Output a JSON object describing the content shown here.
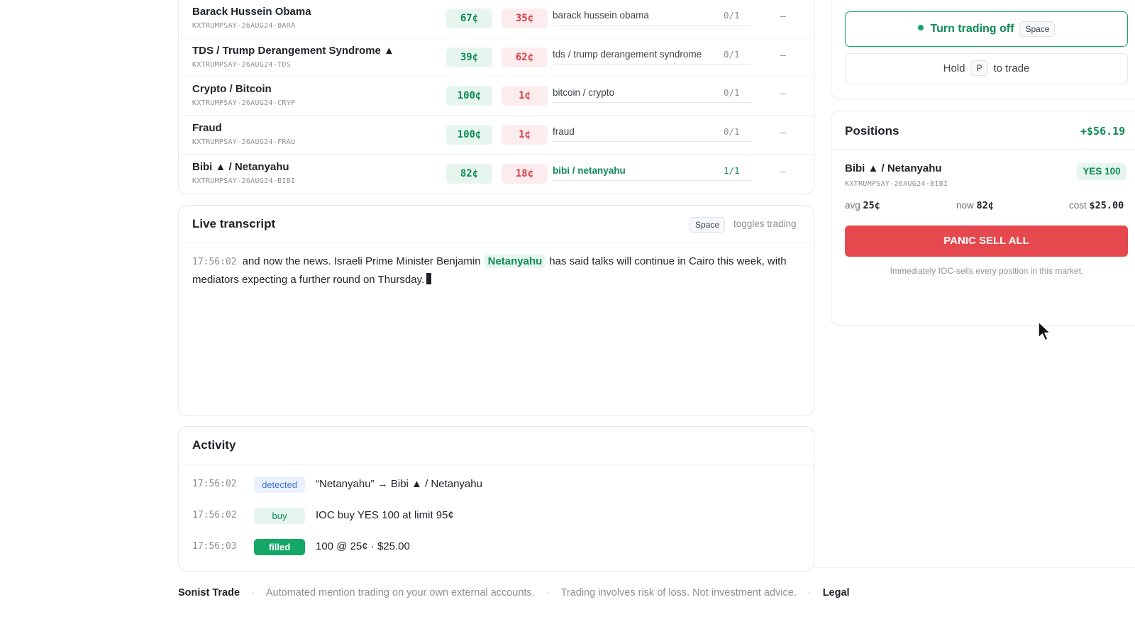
{
  "markets": [
    {
      "name": "Barack Hussein Obama",
      "ticker": "KXTRUMPSAY-26AUG24-BARA",
      "yes": "67¢",
      "no": "35¢",
      "phrase": "barack hussein obama",
      "count": "0/1",
      "action": "–",
      "active": false
    },
    {
      "name": "TDS / Trump Derangement Syndrome ▲",
      "ticker": "KXTRUMPSAY-26AUG24-TDS",
      "yes": "39¢",
      "no": "62¢",
      "phrase": "tds / trump derangement syndrome",
      "count": "0/1",
      "action": "–",
      "active": false
    },
    {
      "name": "Crypto / Bitcoin",
      "ticker": "KXTRUMPSAY-26AUG24-CRYP",
      "yes": "100¢",
      "no": "1¢",
      "phrase": "bitcoin / crypto",
      "count": "0/1",
      "action": "–",
      "active": false
    },
    {
      "name": "Fraud",
      "ticker": "KXTRUMPSAY-26AUG24-FRAU",
      "yes": "100¢",
      "no": "1¢",
      "phrase": "fraud",
      "count": "0/1",
      "action": "–",
      "active": false
    },
    {
      "name": "Bibi ▲ / Netanyahu",
      "ticker": "KXTRUMPSAY-26AUG24-BIBI",
      "yes": "82¢",
      "no": "18¢",
      "phrase": "bibi / netanyahu",
      "count": "1/1",
      "action": "–",
      "active": true
    }
  ],
  "transcript": {
    "title": "Live transcript",
    "kbd": "Space",
    "hint": "toggles trading",
    "time": "17:56:02",
    "text_before": "and now the news. Israeli Prime Minister Benjamin",
    "highlight": "Netanyahu",
    "text_after": "has said talks will continue in Cairo this week, with mediators expecting a further round on Thursday."
  },
  "activity": {
    "title": "Activity",
    "rows": [
      {
        "time": "17:56:02",
        "badge": "detected",
        "text": "“Netanyahu” → Bibi ▲ / Netanyahu"
      },
      {
        "time": "17:56:02",
        "badge": "buy",
        "text": "IOC buy YES 100 at limit 95¢"
      },
      {
        "time": "17:56:03",
        "badge": "filled",
        "text": "100 @ 25¢ · $25.00"
      }
    ]
  },
  "controls": {
    "toggle_label": "Turn trading off",
    "toggle_kbd": "Space",
    "hold_prefix": "Hold",
    "hold_kbd": "P",
    "hold_suffix": "to trade"
  },
  "positions": {
    "title": "Positions",
    "pnl": "+$56.19",
    "item": {
      "name": "Bibi ▲ / Netanyahu",
      "ticker": "KXTRUMPSAY-26AUG24-BIBI",
      "badge": "YES 100",
      "avg_label": "avg",
      "avg": "25¢",
      "now_label": "now",
      "now": "82¢",
      "cost_label": "cost",
      "cost": "$25.00"
    },
    "panic_label": "PANIC SELL ALL",
    "panic_note": "Immediately IOC-sells every position in this market."
  },
  "footer": {
    "brand": "Sonist Trade",
    "sep": "·",
    "tagline": "Automated mention trading on your own external accounts.",
    "disclaimer": "Trading involves risk of loss. Not investment advice.",
    "legal": "Legal"
  },
  "colors": {
    "green": "#14a766",
    "red": "#e5484d",
    "blue": "#3f73d8"
  }
}
